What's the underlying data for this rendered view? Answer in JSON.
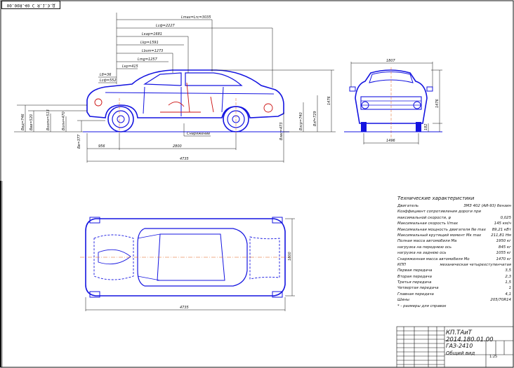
{
  "title_stamp": "00.00Я.40 С Я.1.Э.Д",
  "side_view": {
    "dims": [
      {
        "id": "d1",
        "text": "Lmax=Lrc=3035"
      },
      {
        "id": "d2",
        "text": "Lcф=2227"
      },
      {
        "id": "d3",
        "text": "Lкар=1681"
      },
      {
        "id": "d4",
        "text": "Lkр=1591"
      },
      {
        "id": "d5",
        "text": "Lbsm=1273"
      },
      {
        "id": "d6",
        "text": "Lmg=1257"
      },
      {
        "id": "d7",
        "text": "Lкр=415"
      },
      {
        "id": "d8",
        "text": "Lб=36"
      },
      {
        "id": "d9",
        "text": "Lсф=552"
      }
    ],
    "left_vdims": [
      "Bвд=746",
      "Bвв=520",
      "Bоопн=513",
      "Bопн=470",
      "Bв=377"
    ],
    "right_vdims": [
      "Bзвс=473",
      "Bзср=740",
      "Bзf=729"
    ],
    "height": "1476",
    "front_overhang": "956",
    "wheelbase": "2800",
    "length": "4735",
    "callout": "Снаряжение"
  },
  "front_view": {
    "width": "1807",
    "height": "1476",
    "ground_clearance": "182",
    "track": "1496"
  },
  "top_view": {
    "length": "4735",
    "width": "1800"
  },
  "specs": {
    "header": "Технические характеристики",
    "rows": [
      {
        "k": "Двигатель",
        "v": "ЗМЗ 402 (АИ-93) бензин"
      },
      {
        "k": "Коэффициент сопротивления дороги при",
        "v": ""
      },
      {
        "k": "максимальной скорости, ψ",
        "v": "0,025"
      },
      {
        "k": "Максимальная скорость Vmax",
        "v": "145 км/ч"
      },
      {
        "k": "Максимальная мощность двигателя Nе max",
        "v": "89,21 кВт"
      },
      {
        "k": "Максимальный крутящий момент Мк max",
        "v": "211,81 Нм"
      },
      {
        "k": "Полная масса автомобиля Ма",
        "v": "1950 кг"
      },
      {
        "k": "нагрузка на переднюю ось",
        "v": "845 кг"
      },
      {
        "k": "нагрузка на заднюю ось",
        "v": "1055 кг"
      },
      {
        "k": "Снаряженная масса автомобиля Мо",
        "v": "1470 кг"
      },
      {
        "k": "КПП",
        "v": "механическая четырехступенчатая"
      },
      {
        "k": "Первая передача",
        "v": "3,5"
      },
      {
        "k": "Вторая передача",
        "v": "2,3"
      },
      {
        "k": "Третья передача",
        "v": "1,5"
      },
      {
        "k": "Четвертая передача",
        "v": "1"
      },
      {
        "k": "Главная передача",
        "v": "4,1"
      },
      {
        "k": "Шины",
        "v": "205/70R14"
      }
    ],
    "note": "* - размеры для справок"
  },
  "title_block": {
    "code": "КП.ТАиТ 2014.180.01.00",
    "name": "ГАЗ-2410",
    "subtitle": "Общий вид",
    "scale": "1:25"
  },
  "colors": {
    "line": "#1414e0",
    "frame": "#111111",
    "axis": "#e05a14",
    "detail": "#cc1010"
  }
}
